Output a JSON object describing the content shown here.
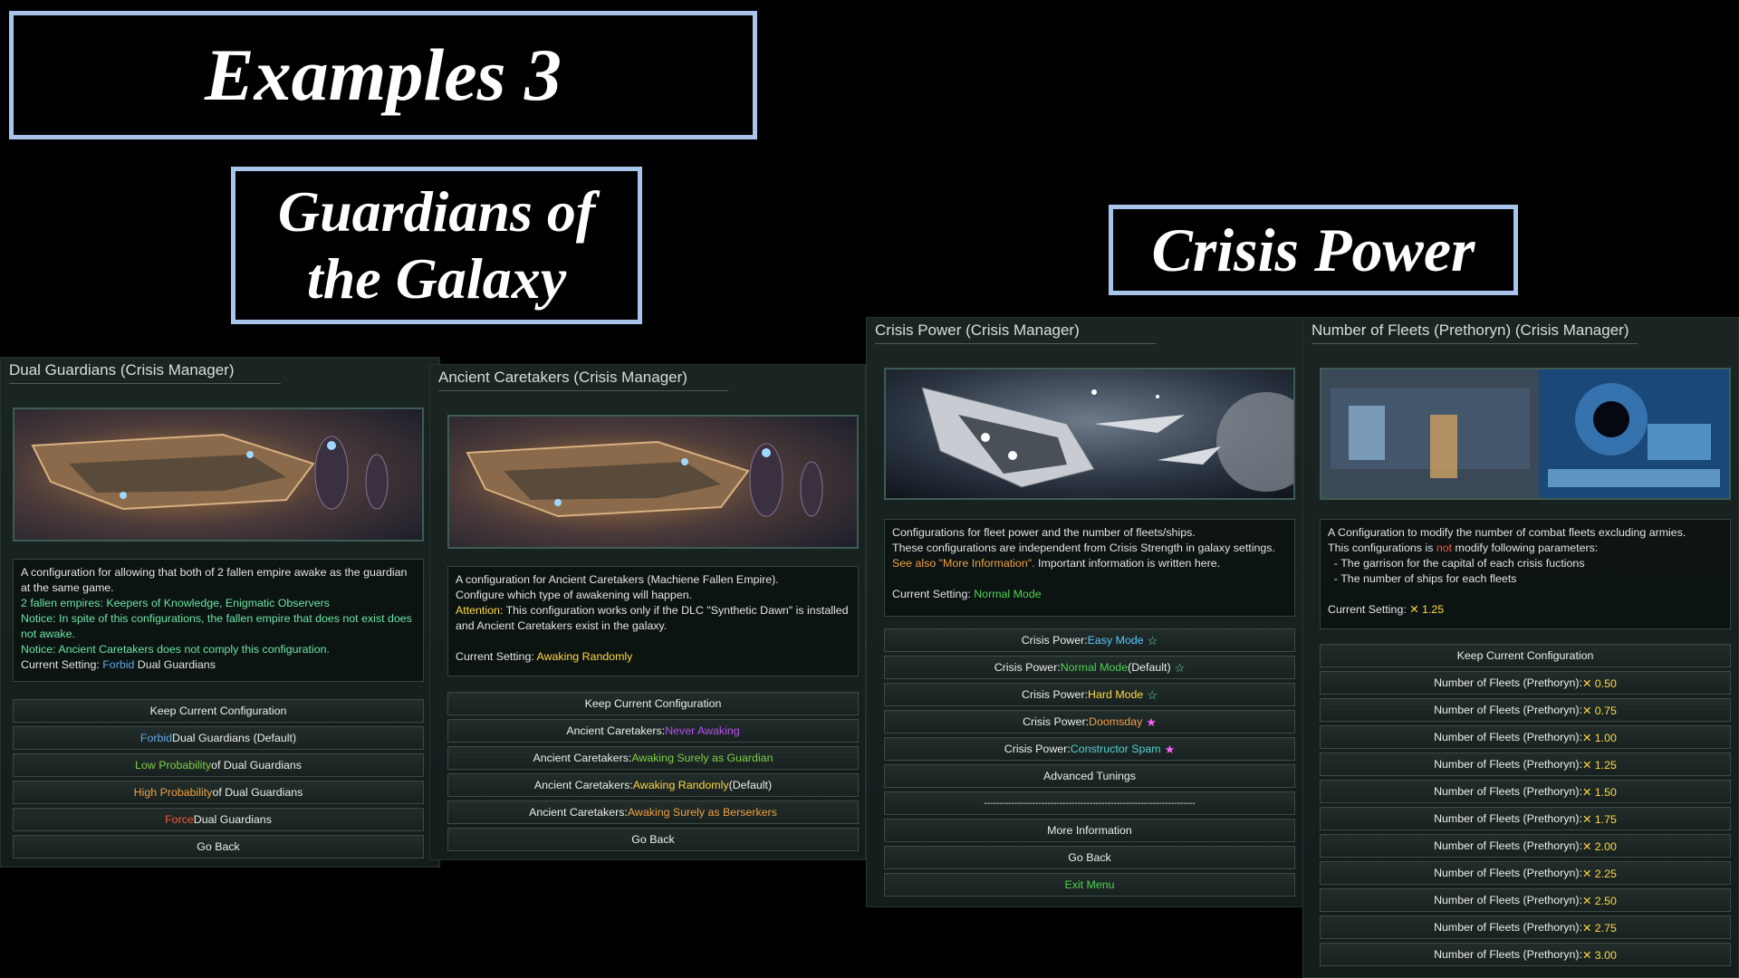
{
  "titles": {
    "main": "Examples 3",
    "guardians": "Guardians of the Galaxy",
    "crisis_power": "Crisis Power"
  },
  "colors": {
    "title_border": "#a9c4ea",
    "panel_bg": "#1a2523",
    "blue": "#5fa8e6",
    "green": "#7fd043",
    "orange": "#f0a040",
    "red": "#f05a3a",
    "purple": "#b44ff0",
    "yellow": "#ffd840"
  },
  "dual": {
    "title": "Dual Guardians (Crisis Manager)",
    "desc": {
      "l1": "A configuration for allowing that both of 2 fallen empire awake as the guardian at the same game.",
      "l2": "2 fallen empires: Keepers of Knowledge, Enigmatic Observers",
      "l3": "Notice: In spite of this configurations, the fallen empire that does not exist does not awake.",
      "l4": "Notice: Ancient Caretakers does not comply this configuration.",
      "cur_prefix": "Current Setting: ",
      "cur_value": "Forbid",
      "cur_suffix": " Dual Guardians"
    },
    "buttons": {
      "keep": "Keep Current Configuration",
      "b1_hl": "Forbid",
      "b1_rest": " Dual Guardians (Default)",
      "b2_hl": "Low Probability",
      "b2_rest": " of Dual Guardians",
      "b3_hl": "High Probability",
      "b3_rest": " of Dual Guardians",
      "b4_hl": "Force",
      "b4_rest": " Dual Guardians",
      "back": "Go Back"
    }
  },
  "ancient": {
    "title": "Ancient Caretakers (Crisis Manager)",
    "desc": {
      "l1": "A configuration for Ancient Caretakers (Machiene Fallen Empire).",
      "l2": "Configure which type of awakening will happen.",
      "l3_hl": "Attention:",
      "l3_rest": " This configuration works only if the DLC \"Synthetic Dawn\" is installed and Ancient Caretakers exist in the galaxy.",
      "cur_prefix": "Current Setting: ",
      "cur_value": "Awaking Randomly"
    },
    "buttons": {
      "keep": "Keep Current Configuration",
      "prefix": "Ancient Caretakers: ",
      "b1_hl": "Never Awaking",
      "b2_hl": "Awaking Surely as Guardian",
      "b3_hl": "Awaking Randomly",
      "b3_rest": " (Default)",
      "b4_hl": "Awaking Surely as Berserkers",
      "back": "Go Back"
    }
  },
  "crisis": {
    "title": "Crisis Power (Crisis Manager)",
    "desc": {
      "l1": "Configurations for fleet power and the number of fleets/ships.",
      "l2": "These configurations are independent from Crisis Strength in galaxy settings.",
      "l3_hl": "See also \"More Information\".",
      "l3_rest": " Important information is written here.",
      "cur_prefix": "Current Setting: ",
      "cur_value": "Normal Mode"
    },
    "buttons": {
      "prefix": "Crisis Power: ",
      "b1_hl": "Easy Mode",
      "b2_hl": "Normal Mode",
      "b2_rest": " (Default)",
      "b3_hl": "Hard Mode",
      "b4_hl": "Doomsday",
      "b5_hl": "Constructor Spam",
      "advanced": "Advanced Tunings",
      "separator": "----------------------------------------------------------------------",
      "more": "More Information",
      "back": "Go Back",
      "exit": "Exit Menu"
    },
    "stars": {
      "green": "☆",
      "pink": "★"
    }
  },
  "fleets": {
    "title": "Number of Fleets (Prethoryn) (Crisis Manager)",
    "desc": {
      "l1": "A Configuration to modify the number of combat fleets excluding armies.",
      "l2_a": "This configurations is ",
      "l2_hl": "not",
      "l2_b": " modify following parameters:",
      "l3": "  - The garrison for the capital of each crisis fuctions",
      "l4": "  - The number of ships for each fleets",
      "cur_prefix": "Current Setting: ",
      "cur_value": "✕ 1.25"
    },
    "keep": "Keep Current Configuration",
    "prefix": "Number of Fleets (Prethoryn): ",
    "values": [
      "✕ 0.50",
      "✕ 0.75",
      "✕ 1.00",
      "✕ 1.25",
      "✕ 1.50",
      "✕ 1.75",
      "✕ 2.00",
      "✕ 2.25",
      "✕ 2.50",
      "✕ 2.75",
      "✕ 3.00"
    ]
  }
}
